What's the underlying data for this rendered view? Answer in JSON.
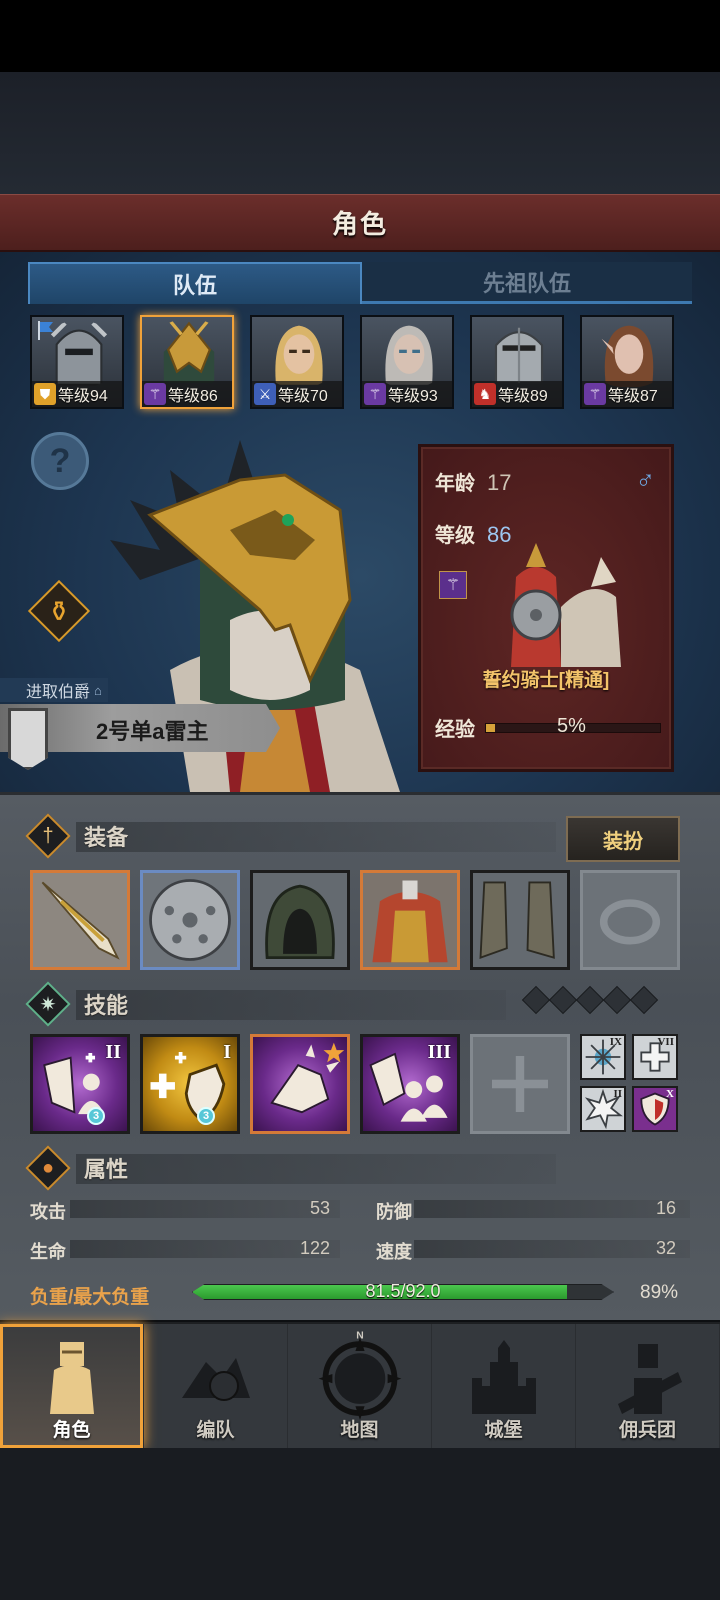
{
  "header": {
    "title": "角色"
  },
  "tabs": [
    {
      "label": "队伍",
      "active": true
    },
    {
      "label": "先祖队伍",
      "active": false
    }
  ],
  "roster": [
    {
      "level_text": "等级94",
      "class_icon": "shield-icon",
      "badge_color": "#e0a12a",
      "face_color": "#8a8f95",
      "selected": false
    },
    {
      "level_text": "等级86",
      "class_icon": "wand-icon",
      "badge_color": "#6a3aa2",
      "face_color": "#c89a3a",
      "selected": true
    },
    {
      "level_text": "等级70",
      "class_icon": "sword-icon",
      "badge_color": "#3e5fb8",
      "face_color": "#d9b97a",
      "selected": false
    },
    {
      "level_text": "等级93",
      "class_icon": "wand-icon",
      "badge_color": "#6a3aa2",
      "face_color": "#bfb3a8",
      "selected": false
    },
    {
      "level_text": "等级89",
      "class_icon": "horse-icon",
      "badge_color": "#c0302a",
      "face_color": "#9aa0a6",
      "selected": false
    },
    {
      "level_text": "等级87",
      "class_icon": "wand-icon",
      "badge_color": "#6a3aa2",
      "face_color": "#b77e5f",
      "selected": false
    }
  ],
  "hero": {
    "noble_title": "进取伯爵",
    "name": "2号单a雷主"
  },
  "info": {
    "age_label": "年龄",
    "age_value": "17",
    "level_label": "等级",
    "level_value": "86",
    "gender_icon": "male-icon",
    "class_name": "誓约骑士[精通]",
    "exp_label": "经验",
    "exp_percent_text": "5%",
    "exp_fraction": 0.05
  },
  "equipment": {
    "title": "装备",
    "dress_button": "装扮",
    "slots": [
      {
        "item": "sword",
        "rarity": "orange"
      },
      {
        "item": "round-shield",
        "rarity": "blue"
      },
      {
        "item": "hood",
        "rarity": "none"
      },
      {
        "item": "armor",
        "rarity": "orange"
      },
      {
        "item": "boots",
        "rarity": "none"
      },
      {
        "item": "ring-empty",
        "rarity": "empty"
      }
    ]
  },
  "skills": {
    "title": "技能",
    "pips": 5,
    "main": [
      {
        "icon": "heal-person-icon",
        "style": "purple",
        "rank": "II",
        "gem": "3"
      },
      {
        "icon": "heal-shield-icon",
        "style": "gold",
        "rank": "I",
        "gem": "3"
      },
      {
        "icon": "shield-strike-icon",
        "style": "purple",
        "rank": "",
        "star": true
      },
      {
        "icon": "group-defend-icon",
        "style": "purple",
        "rank": "III"
      }
    ],
    "mini": [
      {
        "icon": "burst-icon",
        "rank": "IX"
      },
      {
        "icon": "cross-icon",
        "rank": "VII"
      },
      {
        "icon": "explosion-icon",
        "rank": "II"
      },
      {
        "icon": "shield-icon",
        "rank": "X"
      }
    ]
  },
  "attributes": {
    "title": "属性",
    "attack_label": "攻击",
    "attack_value": "53",
    "defense_label": "防御",
    "defense_value": "16",
    "hp_label": "生命",
    "hp_value": "122",
    "speed_label": "速度",
    "speed_value": "32",
    "load_label": "负重/最大负重",
    "load_text": "81.5/92.0",
    "load_percent": "89%",
    "load_fraction": 0.89
  },
  "nav": [
    {
      "label": "角色",
      "icon": "knight-icon",
      "active": true
    },
    {
      "label": "编队",
      "icon": "formation-icon",
      "active": false
    },
    {
      "label": "地图",
      "icon": "compass-map-icon",
      "compass_letter": "N",
      "active": false
    },
    {
      "label": "城堡",
      "icon": "castle-icon",
      "active": false
    },
    {
      "label": "佣兵团",
      "icon": "mercenary-icon",
      "active": false
    }
  ]
}
